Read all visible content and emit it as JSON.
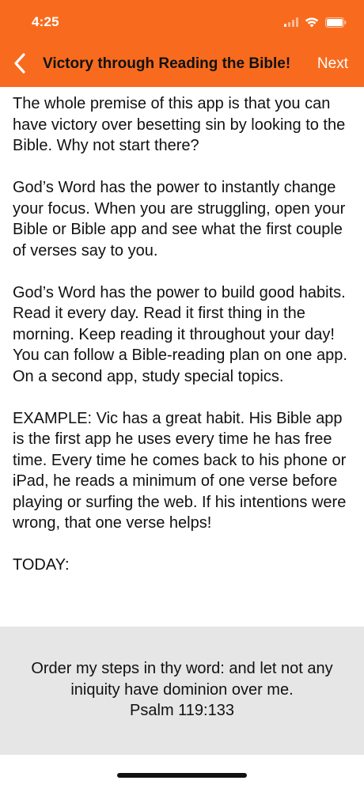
{
  "status_bar": {
    "time": "4:25"
  },
  "nav": {
    "back_icon": "chevron-left-icon",
    "title": "Victory through Reading the Bible!",
    "next_label": "Next"
  },
  "content": {
    "paragraphs": [
      "The whole premise of this app is that you can have victory over besetting sin by looking to the Bible. Why not start there?",
      "God’s Word has the power to instantly change your focus. When you are struggling, open your Bible or Bible app and see what the first couple of verses say to you.",
      "God’s Word has the power to build good habits. Read it every day. Read it first thing in the morning. Keep reading it throughout your day! You can follow a Bible-reading plan on one app. On a second app, study special topics.",
      "EXAMPLE: Vic has a great habit. His Bible app is the first app he uses every time he has free time. Every time he comes back to his phone or iPad, he reads a minimum of one verse before playing or surfing the web. If his intentions were wrong, that one verse helps!",
      "TODAY:"
    ]
  },
  "verse": {
    "text": "Order my steps in thy word: and let not any iniquity have dominion over me.",
    "reference": "Psalm 119:133"
  },
  "colors": {
    "header": "#f86b1e",
    "verse_panel": "#e6e6e6"
  }
}
